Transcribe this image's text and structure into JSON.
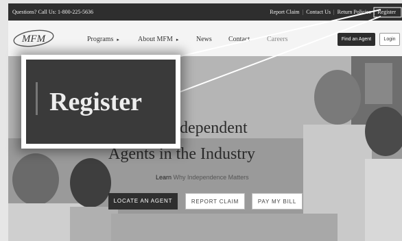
{
  "topbar": {
    "phone": "Questions? Call Us: 1-800-225-5636",
    "links": [
      "Report Claim",
      "Contact Us",
      "Return Policies",
      "Register"
    ]
  },
  "nav": {
    "logo_text": "MFM",
    "items": [
      {
        "label": "Programs",
        "caret": "▸"
      },
      {
        "label": "About MFM",
        "caret": "▸"
      },
      {
        "label": "News",
        "caret": ""
      },
      {
        "label": "Contact",
        "caret": ""
      },
      {
        "label": "Careers",
        "caret": ""
      }
    ],
    "find_agent": "Find an Agent",
    "login": "Login"
  },
  "hero": {
    "headline_line1": "the Best Independent",
    "headline_line2": "Agents in the Industry",
    "learn_prefix": "Learn",
    "learn_link": "Why Independence Matters",
    "buttons": [
      "LOCATE AN AGENT",
      "REPORT CLAIM",
      "PAY MY BILL"
    ]
  },
  "zoom": {
    "word": "Register"
  }
}
